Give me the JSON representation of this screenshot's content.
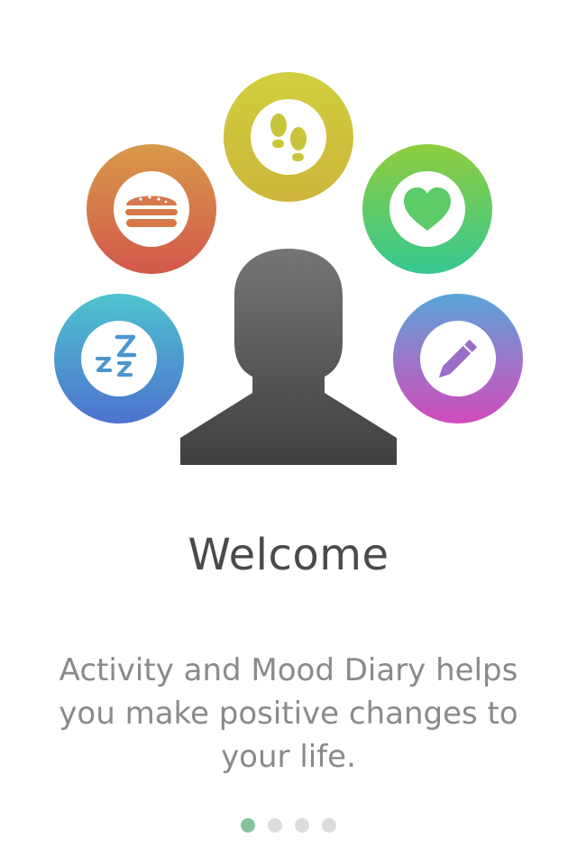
{
  "onboarding": {
    "title": "Welcome",
    "description": "Activity and Mood Diary helps you make positive changes to your life.",
    "page_indicator": {
      "total_pages": 4,
      "current_page": 1
    }
  },
  "illustration": {
    "center_figure": "person-silhouette-icon",
    "badges": [
      {
        "icon": "footprints-icon",
        "colors": [
          "#d0cf3e",
          "#cdb53a"
        ],
        "glyph_color": "#c9c53a"
      },
      {
        "icon": "burger-icon",
        "colors": [
          "#d89a4a",
          "#d2584a"
        ],
        "glyph_color": "#d6784a"
      },
      {
        "icon": "heart-icon",
        "colors": [
          "#8fcd3d",
          "#35c891"
        ],
        "glyph_color": "#5ccb68"
      },
      {
        "icon": "sleep-zzz-icon",
        "colors": [
          "#4fc4cf",
          "#4d72cf"
        ],
        "glyph_color": "#4a96cf"
      },
      {
        "icon": "pencil-icon",
        "colors": [
          "#58a5da",
          "#d04bbb"
        ],
        "glyph_color": "#9a6ec9"
      }
    ]
  },
  "colors": {
    "title": "#4a4a4a",
    "description": "#8a8a8a",
    "dot_active": "#86c39a",
    "dot_inactive": "#dcdcdc"
  }
}
